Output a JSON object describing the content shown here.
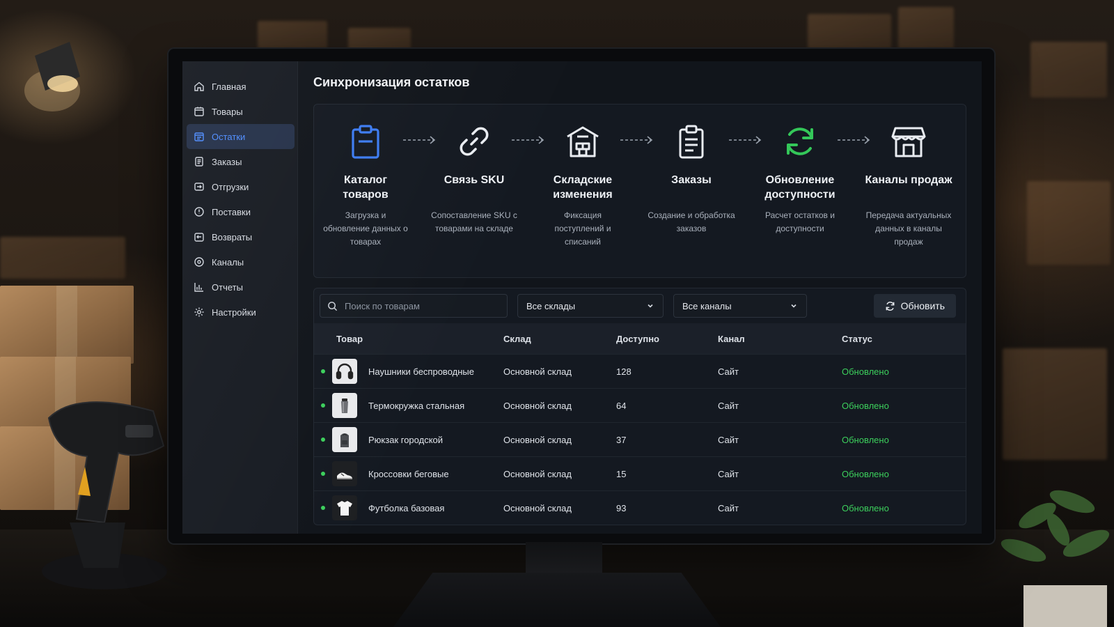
{
  "sidebar": {
    "items": [
      {
        "label": "Главная",
        "icon": "home-icon",
        "active": false
      },
      {
        "label": "Товары",
        "icon": "box-icon",
        "active": false
      },
      {
        "label": "Остатки",
        "icon": "inventory-icon",
        "active": true
      },
      {
        "label": "Заказы",
        "icon": "orders-icon",
        "active": false
      },
      {
        "label": "Отгрузки",
        "icon": "shipments-icon",
        "active": false
      },
      {
        "label": "Поставки",
        "icon": "supplies-icon",
        "active": false
      },
      {
        "label": "Возвраты",
        "icon": "returns-icon",
        "active": false
      },
      {
        "label": "Каналы",
        "icon": "channels-icon",
        "active": false
      },
      {
        "label": "Отчеты",
        "icon": "reports-icon",
        "active": false
      },
      {
        "label": "Настройки",
        "icon": "gear-icon",
        "active": false
      }
    ]
  },
  "page": {
    "title": "Синхронизация остатков"
  },
  "flow": {
    "steps": [
      {
        "title": "Каталог товаров",
        "desc": "Загрузка и обновление данных о товарах",
        "icon": "clipboard-icon",
        "color": "#3d7cf2"
      },
      {
        "title": "Связь SKU",
        "desc": "Сопоставление SKU с товарами на складе",
        "icon": "link-icon",
        "color": "#e9ecf1"
      },
      {
        "title": "Складские изменения",
        "desc": "Фиксация поступлений и списаний",
        "icon": "warehouse-icon",
        "color": "#e9ecf1"
      },
      {
        "title": "Заказы",
        "desc": "Создание и обработка заказов",
        "icon": "order-list-icon",
        "color": "#e9ecf1"
      },
      {
        "title": "Обновление доступности",
        "desc": "Расчет остатков и доступности",
        "icon": "sync-icon",
        "color": "#34c759"
      },
      {
        "title": "Каналы продаж",
        "desc": "Передача актуальных данных в каналы продаж",
        "icon": "storefront-icon",
        "color": "#e9ecf1"
      }
    ]
  },
  "toolbar": {
    "search_placeholder": "Поиск по товарам",
    "warehouse_select": "Все склады",
    "channel_select": "Все каналы",
    "refresh_label": "Обновить"
  },
  "table": {
    "headers": {
      "product": "Товар",
      "warehouse": "Склад",
      "available": "Доступно",
      "channel": "Канал",
      "status": "Статус"
    },
    "rows": [
      {
        "product": "Наушники беспроводные",
        "thumb": "headphones-icon",
        "warehouse": "Основной склад",
        "available": "128",
        "channel": "Сайт",
        "status": "Обновлено"
      },
      {
        "product": "Термокружка стальная",
        "thumb": "thermos-icon",
        "warehouse": "Основной склад",
        "available": "64",
        "channel": "Сайт",
        "status": "Обновлено"
      },
      {
        "product": "Рюкзак городской",
        "thumb": "backpack-icon",
        "warehouse": "Основной склад",
        "available": "37",
        "channel": "Сайт",
        "status": "Обновлено"
      },
      {
        "product": "Кроссовки беговые",
        "thumb": "sneaker-icon",
        "warehouse": "Основной склад",
        "available": "15",
        "channel": "Сайт",
        "status": "Обновлено"
      },
      {
        "product": "Футболка базовая",
        "thumb": "tshirt-icon",
        "warehouse": "Основной склад",
        "available": "93",
        "channel": "Сайт",
        "status": "Обновлено"
      }
    ]
  },
  "colors": {
    "accent": "#4f8dff",
    "status_ok": "#3ccf5c",
    "background": "#11151b"
  }
}
